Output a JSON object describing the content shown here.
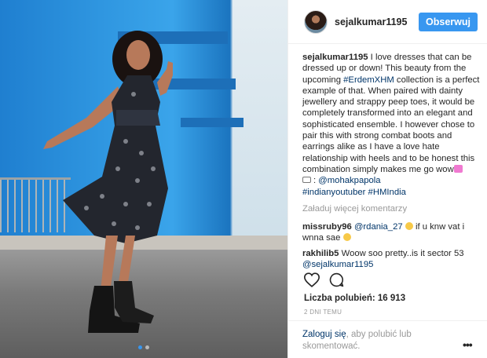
{
  "post": {
    "username": "sejalkumar1195",
    "follow_label": "Obserwuj",
    "caption": {
      "author": "sejalkumar1195",
      "text_1": " I love dresses that can be dressed up or down! This beauty from the upcoming ",
      "hashtag_1": "#ErdemXHM",
      "text_2": " collection is a perfect example of that. When paired with dainty jewellery and strappy peep toes, it would be completely transformed into an elegant and sophisticated ensemble. I however chose to pair this with strong combat boots and earrings alike as I have a love hate relationship with heels and to be honest this combination simply makes me go wow",
      "photo_credit": "@mohakpapola",
      "hashtag_2": "#indianyoutuber",
      "hashtag_3": "#HMIndia"
    },
    "load_more_label": "Załaduj więcej komentarzy",
    "comments": [
      {
        "author": "missruby96",
        "mention": "@rdania_27",
        "text": " if u knw vat i wnna sae"
      },
      {
        "author": "rakhilib5",
        "text": " Woow soo pretty..is it sector 53 ",
        "mention": "@sejalkumar1195"
      }
    ],
    "likes_label": "Liczba polubień: 16 913",
    "time_label": "2 DNI TEMU",
    "login_link": "Zaloguj się",
    "login_text": ", aby polubić lub skomentować.",
    "more_label": "•••"
  },
  "carousel": {
    "count": 2,
    "active_index": 0
  },
  "colors": {
    "accent": "#3897f0",
    "link": "#003569",
    "muted": "#999999"
  },
  "icons": [
    "heart-icon",
    "comment-icon",
    "more-options-icon"
  ]
}
